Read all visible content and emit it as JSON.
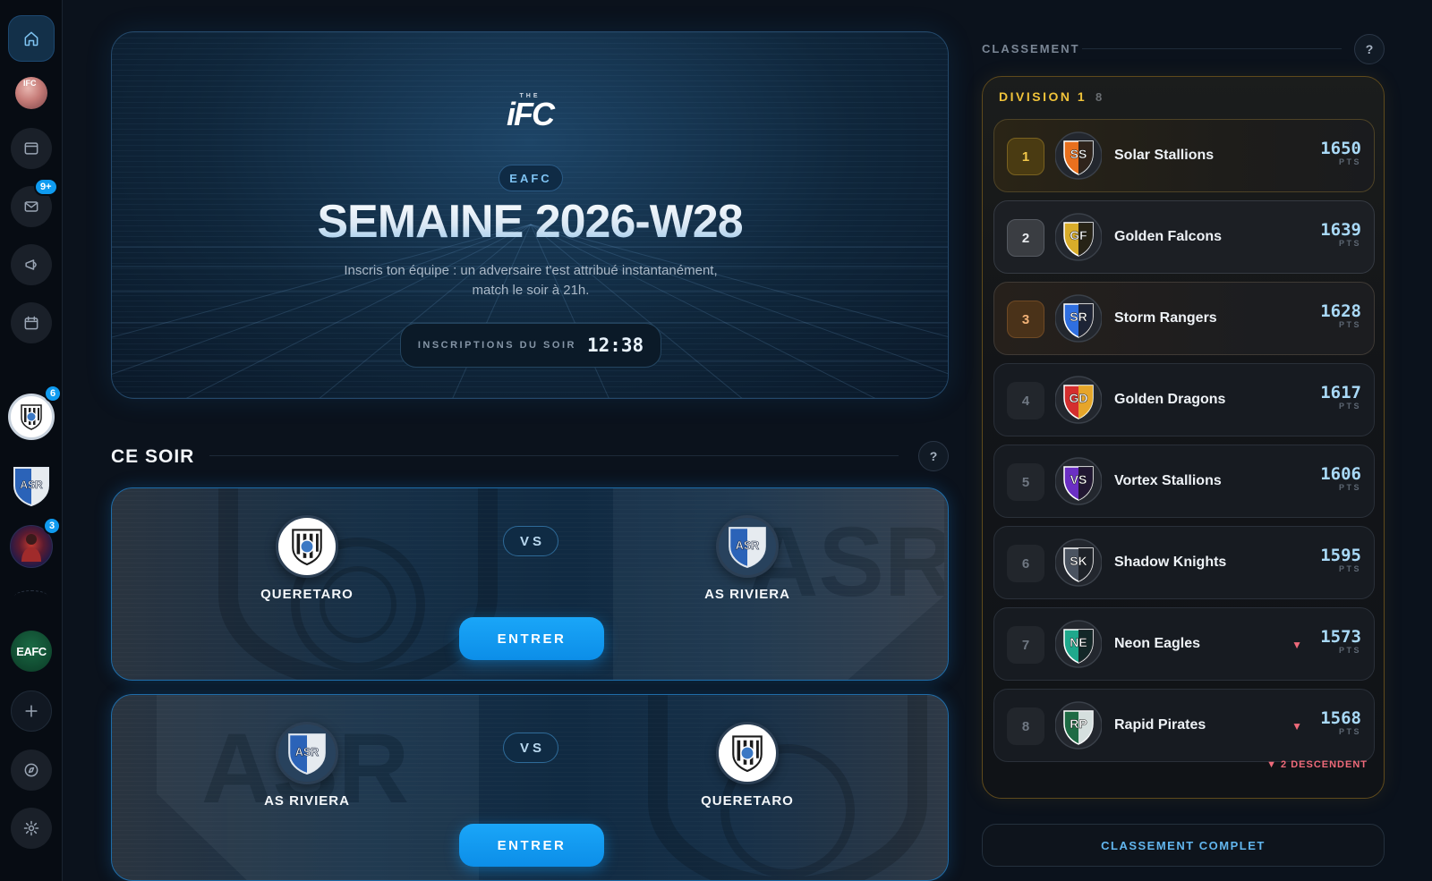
{
  "sidebar": {
    "user_avatar_text": "IFC",
    "mail_badge": "9+",
    "club1_badge": "6",
    "club3_badge": "3",
    "club2_text": "ASR",
    "eafc_label": "EAFC"
  },
  "hero": {
    "logo_small": "THE",
    "logo_main": "iFC",
    "tag": "EAFC",
    "title": "SEMAINE 2026-W28",
    "subtitle_line1": "Inscris ton équipe : un adversaire t'est attribué instantanément,",
    "subtitle_line2": "match le soir à 21h.",
    "countdown_label": "INSCRIPTIONS DU SOIR",
    "countdown_time": "12:38"
  },
  "tonight": {
    "title": "CE SOIR",
    "help": "?",
    "vs_label": "VS",
    "enter_label": "ENTRER",
    "matches": [
      {
        "home": "QUERETARO",
        "away": "AS RIVIERA"
      },
      {
        "home": "AS RIVIERA",
        "away": "QUERETARO"
      }
    ]
  },
  "standings": {
    "header": "CLASSEMENT",
    "help": "?",
    "division": "DIVISION 1",
    "team_count": "8",
    "pts_unit": "PTS",
    "relegation_note": "▼ 2 DESCENDENT",
    "full_button": "CLASSEMENT COMPLET",
    "rows": [
      {
        "pos": "1",
        "abbr": "SS",
        "name": "Solar Stallions",
        "pts": "1650",
        "colors": [
          "#e8701e",
          "#1b1b1b"
        ],
        "down": false
      },
      {
        "pos": "2",
        "abbr": "GF",
        "name": "Golden Falcons",
        "pts": "1639",
        "colors": [
          "#d8ac2a",
          "#141414"
        ],
        "down": false
      },
      {
        "pos": "3",
        "abbr": "SR",
        "name": "Storm Rangers",
        "pts": "1628",
        "colors": [
          "#2f6fe0",
          "#1c1c24"
        ],
        "down": false
      },
      {
        "pos": "4",
        "abbr": "GD",
        "name": "Golden Dragons",
        "pts": "1617",
        "colors": [
          "#d42e2e",
          "#e8b22a"
        ],
        "down": false
      },
      {
        "pos": "5",
        "abbr": "VS",
        "name": "Vortex Stallions",
        "pts": "1606",
        "colors": [
          "#6b2fc4",
          "#1a1522"
        ],
        "down": false
      },
      {
        "pos": "6",
        "abbr": "SK",
        "name": "Shadow Knights",
        "pts": "1595",
        "colors": [
          "#4a5360",
          "#1a1d22"
        ],
        "down": false
      },
      {
        "pos": "7",
        "abbr": "NE",
        "name": "Neon Eagles",
        "pts": "1573",
        "colors": [
          "#1fa88c",
          "#12181c"
        ],
        "down": true
      },
      {
        "pos": "8",
        "abbr": "RP",
        "name": "Rapid Pirates",
        "pts": "1568",
        "colors": [
          "#1e6b44",
          "#e9ecef"
        ],
        "down": true
      }
    ]
  }
}
